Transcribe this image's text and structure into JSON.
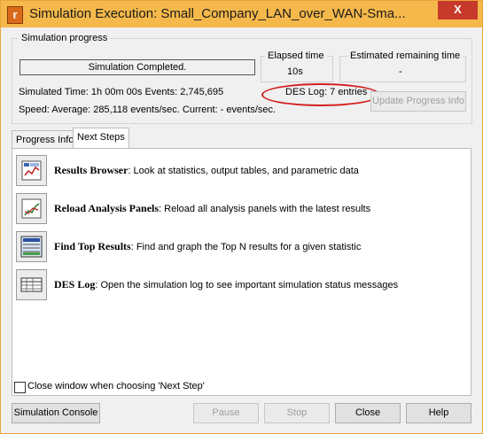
{
  "window": {
    "title": "Simulation Execution: Small_Company_LAN_over_WAN-Sma...",
    "app_icon_glyph": "r",
    "close_glyph": "X"
  },
  "progress": {
    "group_label": "Simulation progress",
    "status_text": "Simulation Completed.",
    "elapsed_label": "Elapsed time",
    "elapsed_value": "10s",
    "remaining_label": "Estimated remaining time",
    "remaining_value": "-",
    "simulated_time_line": "Simulated Time:  1h 00m 00s  Events:  2,745,695",
    "speed_line": "Speed:  Average:  285,118 events/sec.  Current:  - events/sec.",
    "des_log_text": "DES Log: 7 entries",
    "update_button": "Update Progress Info"
  },
  "tabs": [
    {
      "label": "Progress Info"
    },
    {
      "label": "Next Steps"
    }
  ],
  "steps": [
    {
      "name": "Results Browser",
      "desc": ": Look at statistics, output tables, and parametric data"
    },
    {
      "name": "Reload Analysis Panels",
      "desc": ": Reload all analysis panels with the latest results"
    },
    {
      "name": "Find Top Results",
      "desc": ": Find and graph the Top N results for a given statistic"
    },
    {
      "name": "DES Log",
      "desc": ": Open the simulation log to see important simulation status messages"
    }
  ],
  "close_checkbox_label": "Close window when choosing 'Next Step'",
  "buttons": {
    "console": "Simulation Console",
    "pause": "Pause",
    "stop": "Stop",
    "close": "Close",
    "help": "Help"
  },
  "colors": {
    "titlebar": "#f5b84a",
    "close_button": "#c7392a",
    "highlight_ellipse": "#d42020"
  }
}
